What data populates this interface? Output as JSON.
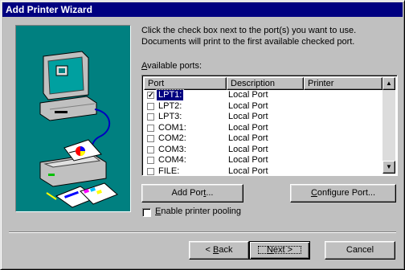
{
  "window": {
    "title": "Add Printer Wizard"
  },
  "instructions": "Click the check box next to the port(s) you want to use. Documents will print to the first available checked port.",
  "available_ports": {
    "label_first": "A",
    "label_rest": "vailable ports:"
  },
  "list": {
    "columns": [
      "Port",
      "Description",
      "Printer"
    ],
    "rows": [
      {
        "port": "LPT1:",
        "description": "Local Port",
        "printer": "",
        "checked": true,
        "selected": true
      },
      {
        "port": "LPT2:",
        "description": "Local Port",
        "printer": "",
        "checked": false
      },
      {
        "port": "LPT3:",
        "description": "Local Port",
        "printer": "",
        "checked": false
      },
      {
        "port": "COM1:",
        "description": "Local Port",
        "printer": "",
        "checked": false
      },
      {
        "port": "COM2:",
        "description": "Local Port",
        "printer": "",
        "checked": false
      },
      {
        "port": "COM3:",
        "description": "Local Port",
        "printer": "",
        "checked": false
      },
      {
        "port": "COM4:",
        "description": "Local Port",
        "printer": "",
        "checked": false
      },
      {
        "port": "FILE:",
        "description": "Local Port",
        "printer": "",
        "checked": false
      }
    ]
  },
  "buttons": {
    "add_port_first": "Add Por",
    "add_port_u": "t",
    "add_port_rest": "...",
    "configure_port_u": "C",
    "configure_port_rest": "onfigure Port...",
    "back_prefix": "< ",
    "back_u": "B",
    "back_rest": "ack",
    "next_u": "N",
    "next_rest": "ext >",
    "cancel": "Cancel"
  },
  "pooling": {
    "checked": false,
    "label_u": "E",
    "label_rest": "nable printer pooling"
  },
  "colors": {
    "titlebar": "#000080",
    "face": "#c0c0c0",
    "art_bg": "#008080"
  }
}
